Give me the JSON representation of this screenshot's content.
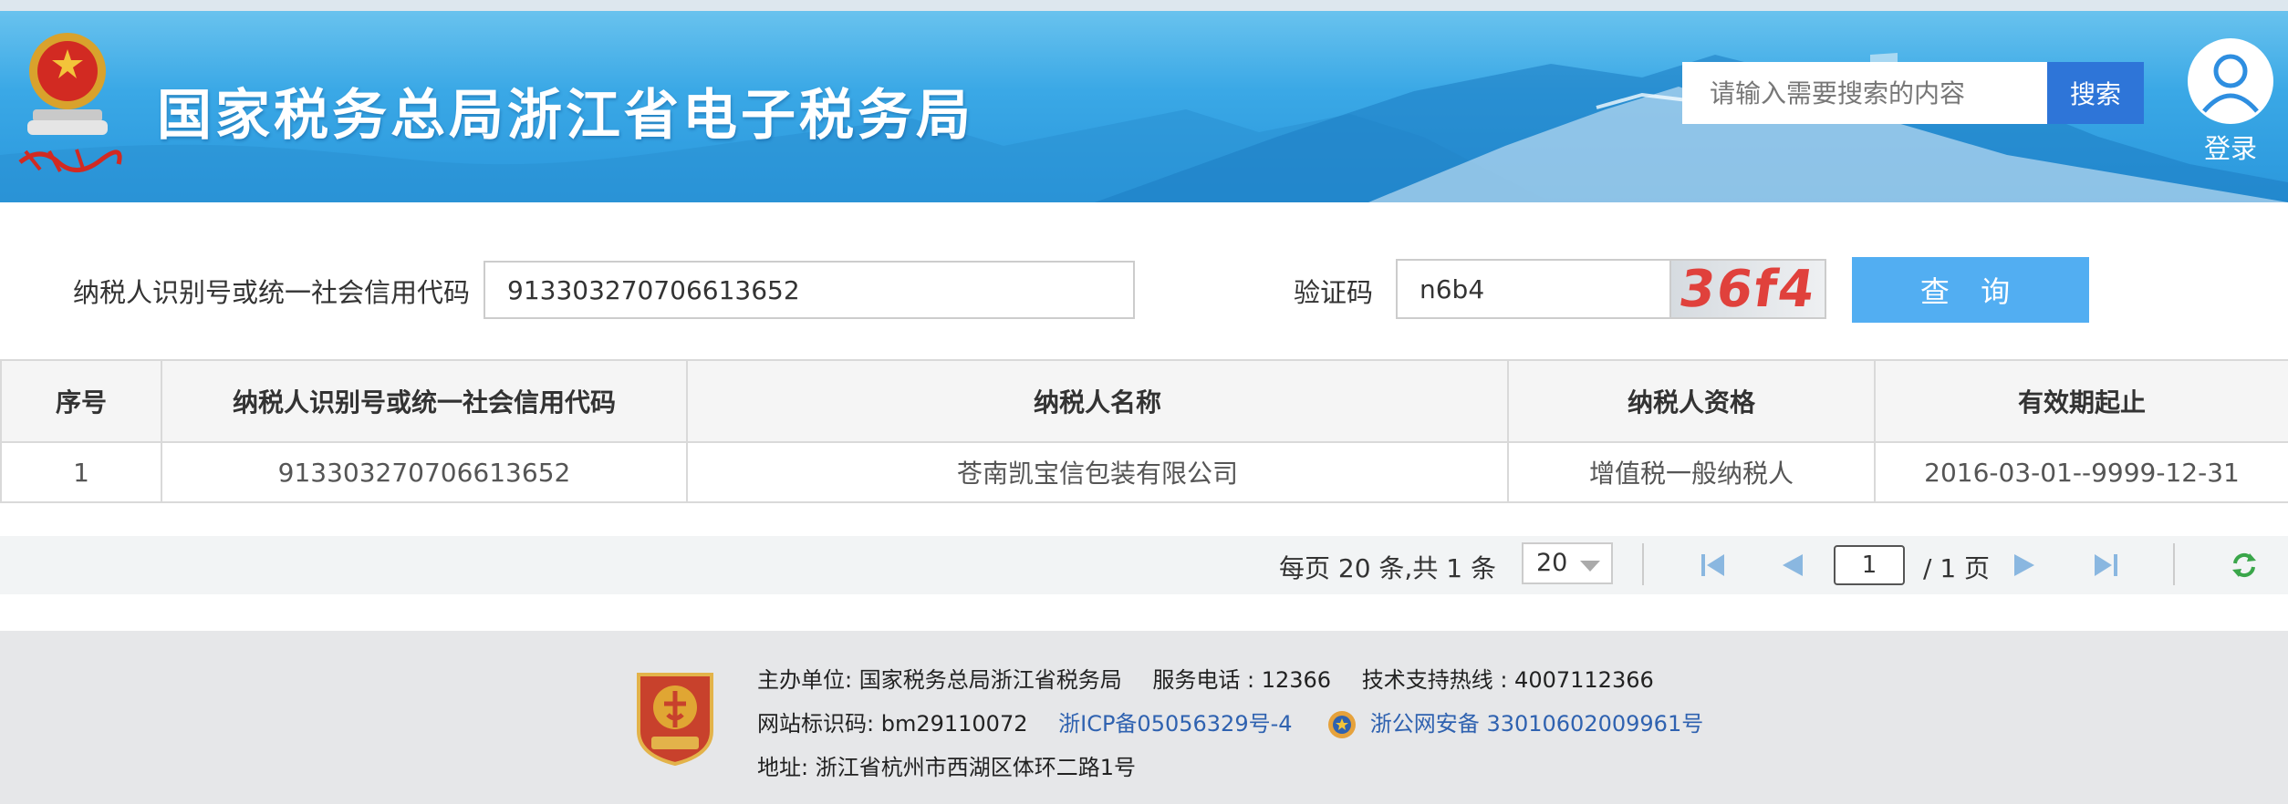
{
  "header": {
    "site_title": "国家税务总局浙江省电子税务局",
    "search_placeholder": "请输入需要搜索的内容",
    "search_button": "搜索",
    "login_label": "登录"
  },
  "query": {
    "taxpayer_id_label": "纳税人识别号或统一社会信用代码",
    "taxpayer_id_value": "913303270706613652",
    "captcha_label": "验证码",
    "captcha_value": "n6b4",
    "captcha_image_text": "36f4",
    "query_button": "查 询"
  },
  "table": {
    "headers": [
      "序号",
      "纳税人识别号或统一社会信用代码",
      "纳税人名称",
      "纳税人资格",
      "有效期起止"
    ],
    "rows": [
      [
        "1",
        "913303270706613652",
        "苍南凯宝信包装有限公司",
        "增值税一般纳税人",
        "2016-03-01--9999-12-31"
      ]
    ]
  },
  "pagination": {
    "info": "每页 20 条,共 1 条",
    "page_size": "20",
    "current_page": "1",
    "total_pages": "/ 1 页"
  },
  "footer": {
    "sponsor_label": "主办单位:",
    "sponsor": "国家税务总局浙江省税务局",
    "service_phone": "服务电话 : 12366",
    "support_hotline": "技术支持热线 : 4007112366",
    "site_id": "网站标识码:  bm29110072",
    "icp": "浙ICP备05056329号-4",
    "police": "浙公网安备 33010602009961号",
    "address": "地址:  浙江省杭州市西湖区体环二路1号"
  },
  "colors": {
    "header_blue": "#3aa8e6",
    "search_button": "#2e75d8",
    "query_button": "#52aef2",
    "link": "#2f62b0",
    "captcha_text": "#e0413c"
  },
  "icons": [
    "national-emblem-icon",
    "user-avatar-icon",
    "first-page-icon",
    "prev-page-icon",
    "next-page-icon",
    "last-page-icon",
    "refresh-icon",
    "party-badge-icon",
    "police-badge-icon"
  ]
}
